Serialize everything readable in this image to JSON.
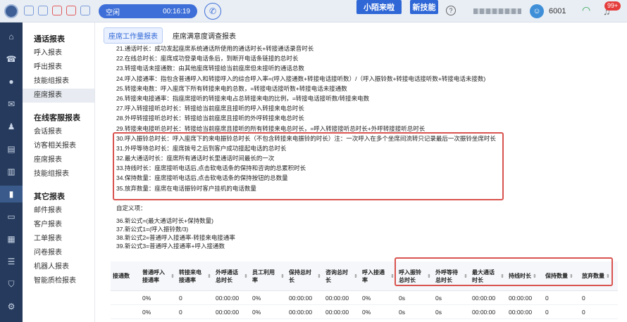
{
  "topbar": {
    "status_label": "空闲",
    "timer": "00:16:19",
    "pill_left": "小陌来啦",
    "pill_right": "新技能",
    "agent_id": "6001",
    "badge": "99+"
  },
  "sidebar": {
    "section1": {
      "title": "通话报表",
      "items": [
        "呼入报表",
        "呼出报表",
        "技能组报表",
        "座席报表"
      ]
    },
    "section2": {
      "title": "在线客服报表",
      "items": [
        "会话报表",
        "访客相关报表",
        "座席报表",
        "技能组报表"
      ]
    },
    "section3": {
      "title": "其它报表",
      "items": [
        "邮件报表",
        "客户报表",
        "工单报表",
        "问卷报表",
        "机器人报表",
        "智能质检报表"
      ]
    }
  },
  "tabs": [
    "座席工作量报表",
    "座席满意度调查报表"
  ],
  "content": {
    "lines": [
      "21.通话时长：成功发起座席系统通话所使用的通话时长+转接通话录音时长",
      "22.在线总时长：座席成功登录电话条后，到断开电话条链接的总时长",
      "23.转接电话未接通数：由其他座席转接给当前座席但未接听的通话总数",
      "24.呼入接通率：指包含普通呼入和转接呼入的综合呼入率=(呼入接通数+转接电话接听数）/（呼入振铃数+转接电话接听数+转接电话未接数)",
      "25.转接来电数：呼入座席下所有转接来电的总数，=转接电话接听数+转接电话未接通数",
      "26.转接来电接通率：指座席接听的转接来电占总转接来电的比例，=转接电话接听数/转接来电数",
      "27.呼入转接接听总时长：转接给当前座席且接听的呼入转接来电总时长",
      "28.外呼转接接听总时长：转接给当前座席且接听的外呼转接来电总时长",
      "29.转接来电接听总时长：转接给当前座席且接听的所有转接来电总时长，=呼入转接接听总时长+外呼转接接听总时长",
      "30.呼入振铃总时长：呼入座席下的来电振铃总时长（不包含转接来电振铃的时长）注：一次呼入在多个坐席间流转只记录最后一次振铃坐席时长",
      "31.外呼等待总时长：座席拨号之后到客户成功接起电话的总时长",
      "32.最大通话时长：座席所有通话时长里通话时间最长的一次",
      "33.持线时长：座席接听电话后,点击软电话条的保持和咨询的总累积时长",
      "34.保持数量：座席接听电话后,点击软电话条的保持按钮的总数量",
      "35.放弃数量：座席在电话振铃时客户挂机的电话数量"
    ],
    "custom_title": "自定义项：",
    "custom_lines": [
      "36.新公式=(最大通话时长+保持数量)",
      "37.新公式1=(呼入振铃数/3)",
      "38.新公式2=普通呼入接通率-转接来电接通率",
      "39.新公式3=普通呼入接通率+呼入接通数"
    ]
  },
  "table": {
    "headers": [
      "接通数",
      "普通呼入接通率",
      "转接来电接通率",
      "外呼通话总时长",
      "员工利用率",
      "保持总时长",
      "咨询总时长",
      "呼入接通率",
      "呼入振铃总时长",
      "外呼等待总时长",
      "最大通话时长",
      "持线时长",
      "保持数量",
      "放弃数量"
    ],
    "rows": [
      [
        "",
        "0%",
        "0",
        "00:00:00",
        "0%",
        "00:00:00",
        "00:00:00",
        "0%",
        "0s",
        "0s",
        "00:00:00",
        "00:00:00",
        "0",
        "0"
      ],
      [
        "",
        "0%",
        "0",
        "00:00:00",
        "0%",
        "00:00:00",
        "00:00:00",
        "0%",
        "0s",
        "0s",
        "00:00:00",
        "00:00:00",
        "0",
        "0"
      ]
    ]
  }
}
